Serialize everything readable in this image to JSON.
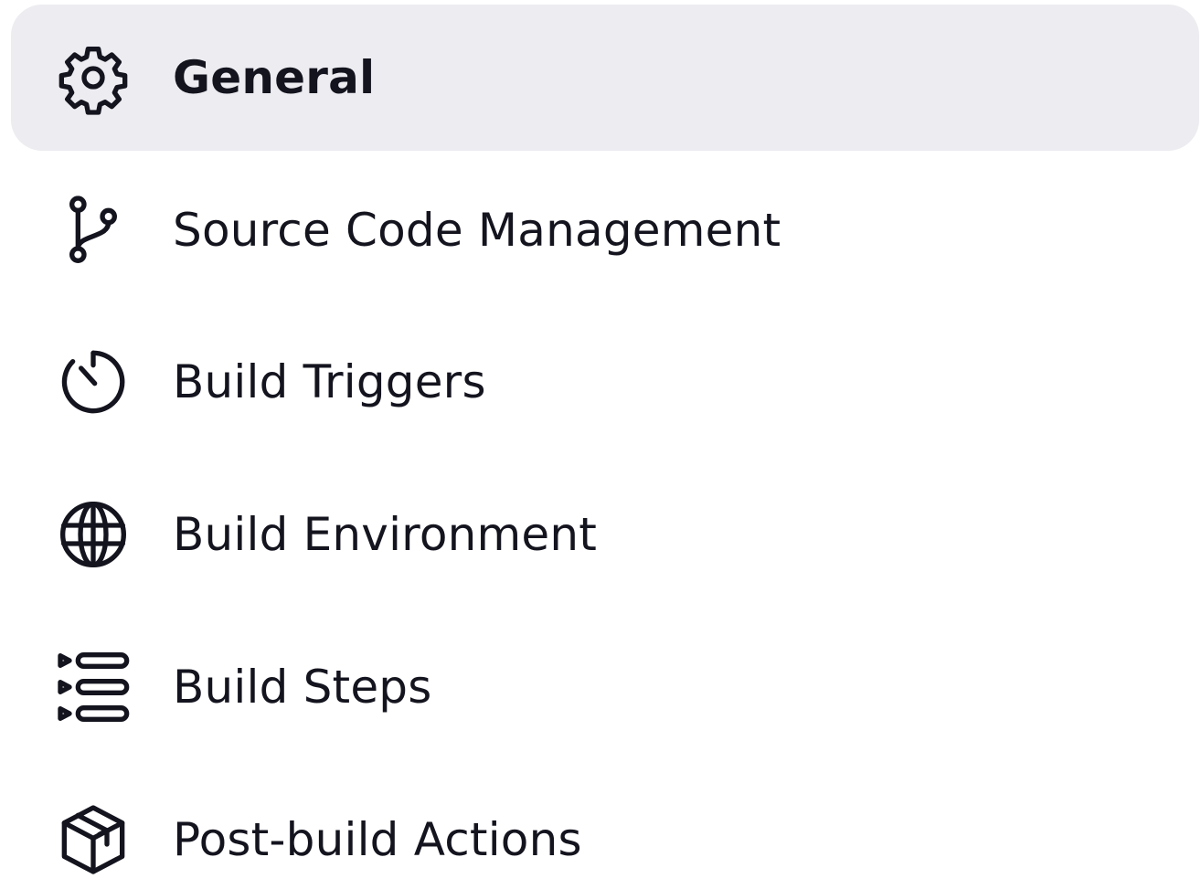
{
  "sidebar": {
    "items": [
      {
        "label": "General",
        "icon": "gear-icon",
        "active": true
      },
      {
        "label": "Source Code Management",
        "icon": "git-branch-icon",
        "active": false
      },
      {
        "label": "Build Triggers",
        "icon": "timer-icon",
        "active": false
      },
      {
        "label": "Build Environment",
        "icon": "globe-icon",
        "active": false
      },
      {
        "label": "Build Steps",
        "icon": "list-steps-icon",
        "active": false
      },
      {
        "label": "Post-build Actions",
        "icon": "package-icon",
        "active": false
      }
    ]
  },
  "colors": {
    "text": "#14141f",
    "active_background": "#ececf1"
  }
}
